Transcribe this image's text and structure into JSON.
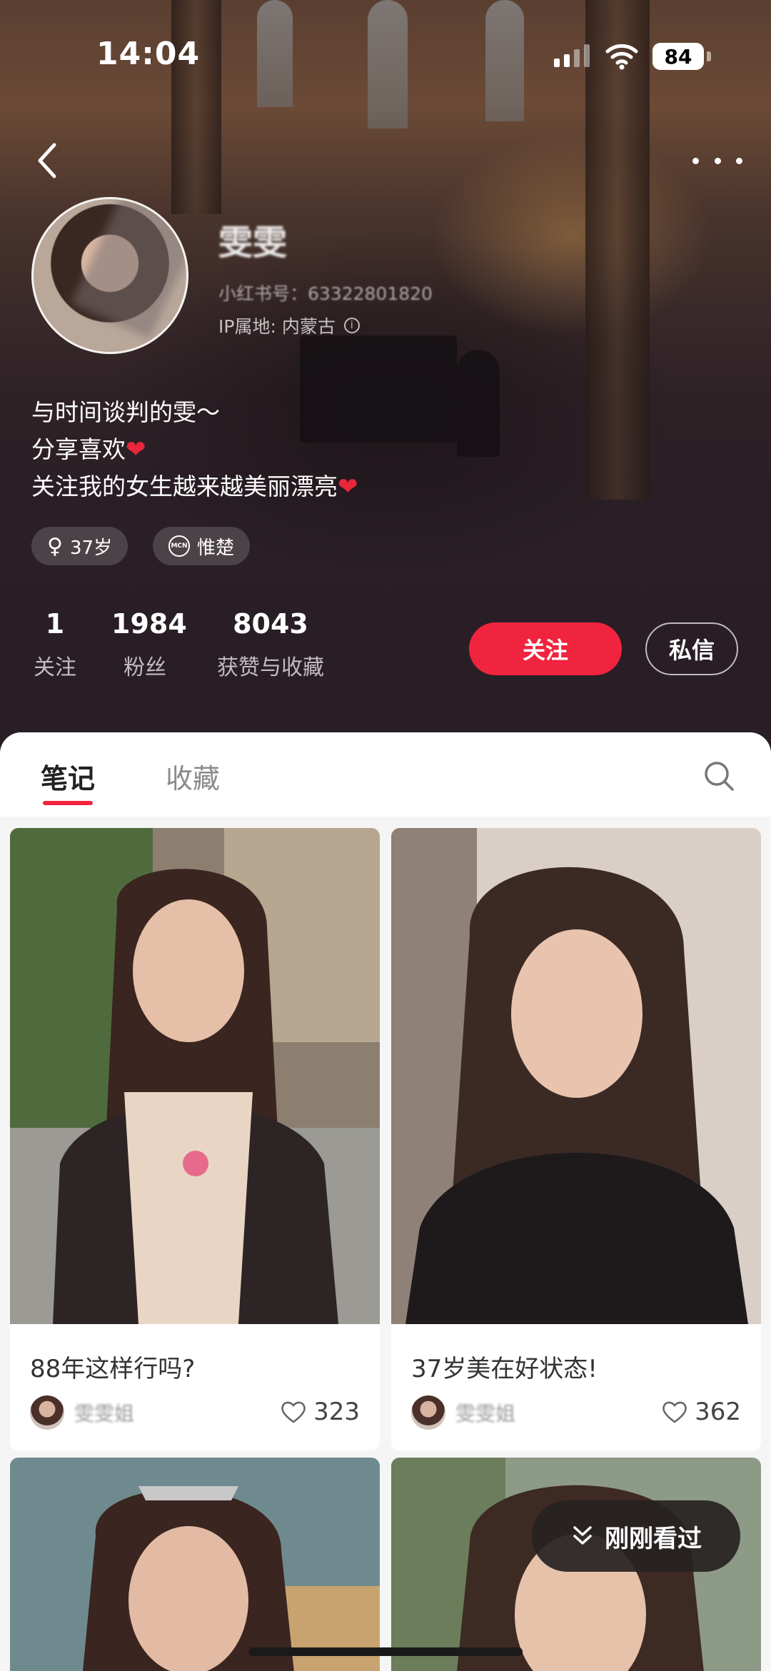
{
  "status_bar": {
    "time": "14:04",
    "battery": "84"
  },
  "profile": {
    "nickname": "雯雯",
    "red_id": "小红书号：63322801820",
    "ip_location": "IP属地: 内蒙古",
    "bio": [
      {
        "text": "与时间谈判的雯～",
        "emoji": ""
      },
      {
        "text": "分享喜欢",
        "emoji": "❤"
      },
      {
        "text": "关注我的女生越来越美丽漂亮",
        "emoji": "❤"
      }
    ],
    "tags": [
      {
        "icon": "female-icon",
        "glyph": "♀",
        "label": "37岁"
      },
      {
        "icon": "mcn-icon",
        "glyph": "MCN",
        "label": "惟楚"
      }
    ],
    "stats": [
      {
        "value": "1",
        "label": "关注"
      },
      {
        "value": "1984",
        "label": "粉丝"
      },
      {
        "value": "8043",
        "label": "获赞与收藏"
      }
    ],
    "follow_label": "关注",
    "message_label": "私信"
  },
  "tabs": [
    {
      "label": "笔记",
      "active": true
    },
    {
      "label": "收藏",
      "active": false
    }
  ],
  "notes": [
    {
      "title": "88年这样行吗?",
      "author": "雯雯姐",
      "likes": "323"
    },
    {
      "title": "37岁美在好状态!",
      "author": "雯雯姐",
      "likes": "362"
    }
  ],
  "recently_viewed_label": "刚刚看过",
  "colors": {
    "accent": "#f0243e",
    "header_bg": "#2a1f26"
  }
}
